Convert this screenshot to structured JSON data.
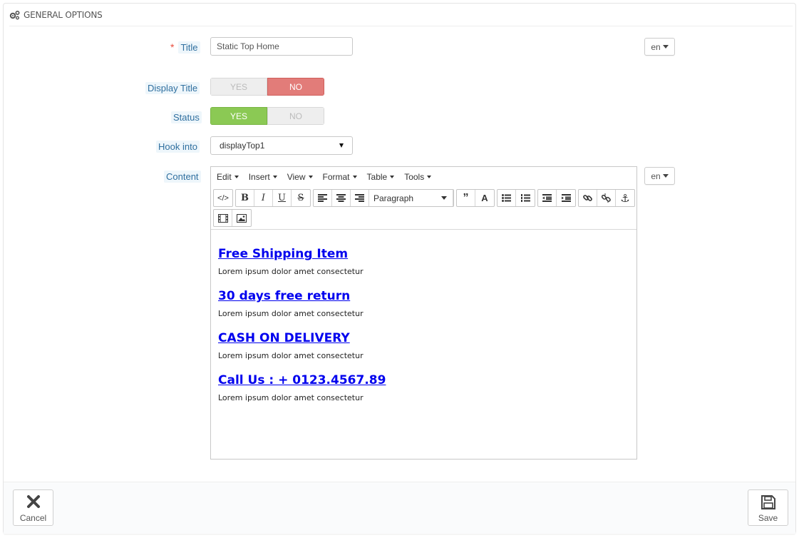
{
  "panel": {
    "heading": "GENERAL OPTIONS",
    "heading_icon": "cogs-icon"
  },
  "form": {
    "title": {
      "label": "Title",
      "required_mark": "*",
      "value": "Static Top Home",
      "lang": "en"
    },
    "display_title": {
      "label": "Display Title",
      "yes": "YES",
      "no": "NO",
      "selected": "no",
      "active_color": "#e27c79"
    },
    "status": {
      "label": "Status",
      "yes": "YES",
      "no": "NO",
      "selected": "yes",
      "active_color": "#8bc954"
    },
    "hook_into": {
      "label": "Hook into",
      "value": "displayTop1"
    },
    "content": {
      "label": "Content",
      "lang": "en",
      "menus": [
        "Edit",
        "Insert",
        "View",
        "Format",
        "Table",
        "Tools"
      ],
      "format_select": "Paragraph",
      "toolbar_icons": [
        "source-code-icon",
        "bold-icon",
        "italic-icon",
        "underline-icon",
        "strikethrough-icon",
        "align-left-icon",
        "align-center-icon",
        "align-right-icon",
        "blockquote-icon",
        "text-color-icon",
        "bullet-list-icon",
        "numbered-list-icon",
        "outdent-icon",
        "indent-icon",
        "link-icon",
        "unlink-icon",
        "anchor-icon",
        "video-icon",
        "image-icon"
      ],
      "blocks": [
        {
          "heading": "Free Shipping Item",
          "text": "Lorem ipsum dolor amet consectetur"
        },
        {
          "heading": "30 days free return",
          "text": "Lorem ipsum dolor amet consectetur"
        },
        {
          "heading": "CASH ON DELIVERY",
          "text": "Lorem ipsum dolor amet consectetur"
        },
        {
          "heading": "Call Us : + 0123.4567.89",
          "text": "Lorem ipsum dolor amet consectetur"
        }
      ]
    }
  },
  "footer": {
    "cancel_label": "Cancel",
    "save_label": "Save"
  },
  "colors": {
    "label_blue": "#2f6f9f",
    "link_blue": "#0000ee",
    "required_red": "#e84c3d"
  }
}
